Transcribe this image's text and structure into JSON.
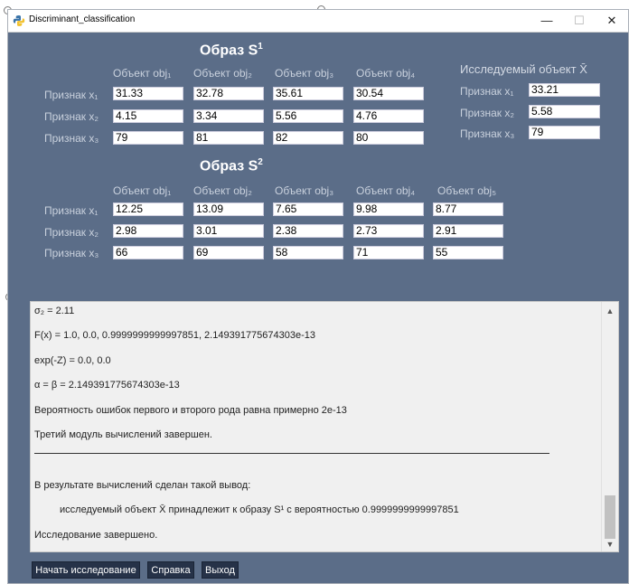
{
  "window": {
    "title": "Discriminant_classification",
    "min_glyph": "—",
    "max_glyph": "☐",
    "close_glyph": "✕"
  },
  "sample1": {
    "heading": "Образ S",
    "heading_sup": "1",
    "objects": [
      "Объект obj₁",
      "Объект obj₂",
      "Объект obj₃",
      "Объект obj₄"
    ],
    "features": [
      "Признак x₁",
      "Признак x₂",
      "Признак x₃"
    ],
    "values": [
      [
        "31.33",
        "32.78",
        "35.61",
        "30.54"
      ],
      [
        "4.15",
        "3.34",
        "5.56",
        "4.76"
      ],
      [
        "79",
        "81",
        "82",
        "80"
      ]
    ]
  },
  "test_object": {
    "heading": "Исследуемый объект X̄",
    "features": [
      "Признак x₁",
      "Признак x₂",
      "Признак x₃"
    ],
    "values": [
      "33.21",
      "5.58",
      "79"
    ]
  },
  "sample2": {
    "heading": "Образ S",
    "heading_sup": "2",
    "objects": [
      "Объект obj₁",
      "Объект obj₂",
      "Объект obj₃",
      "Объект obj₄",
      "Объект obj₅"
    ],
    "features": [
      "Признак x₁",
      "Признак x₂",
      "Признак x₃"
    ],
    "values": [
      [
        "12.25",
        "13.09",
        "7.65",
        "9.98",
        "8.77"
      ],
      [
        "2.98",
        "3.01",
        "2.38",
        "2.73",
        "2.91"
      ],
      [
        "66",
        "69",
        "58",
        "71",
        "55"
      ]
    ]
  },
  "output": {
    "lines": [
      "σ₂ = 2.11",
      "F(x) = 1.0, 0.0, 0.9999999999997851, 2.149391775674303e-13",
      "exp(-Z) = 0.0, 0.0",
      "α = β = 2.149391775674303e-13",
      "Вероятность ошибок первого и второго рода равна примерно 2e-13",
      "Третий модуль вычислений завершен.",
      "В результате вычислений сделан такой вывод:",
      "исследуемый объект X̄ принадлежит к образу S¹ с вероятностью 0.9999999999997851",
      "Исследование завершено."
    ]
  },
  "buttons": {
    "start": "Начать исследование",
    "help": "Справка",
    "exit": "Выход"
  }
}
